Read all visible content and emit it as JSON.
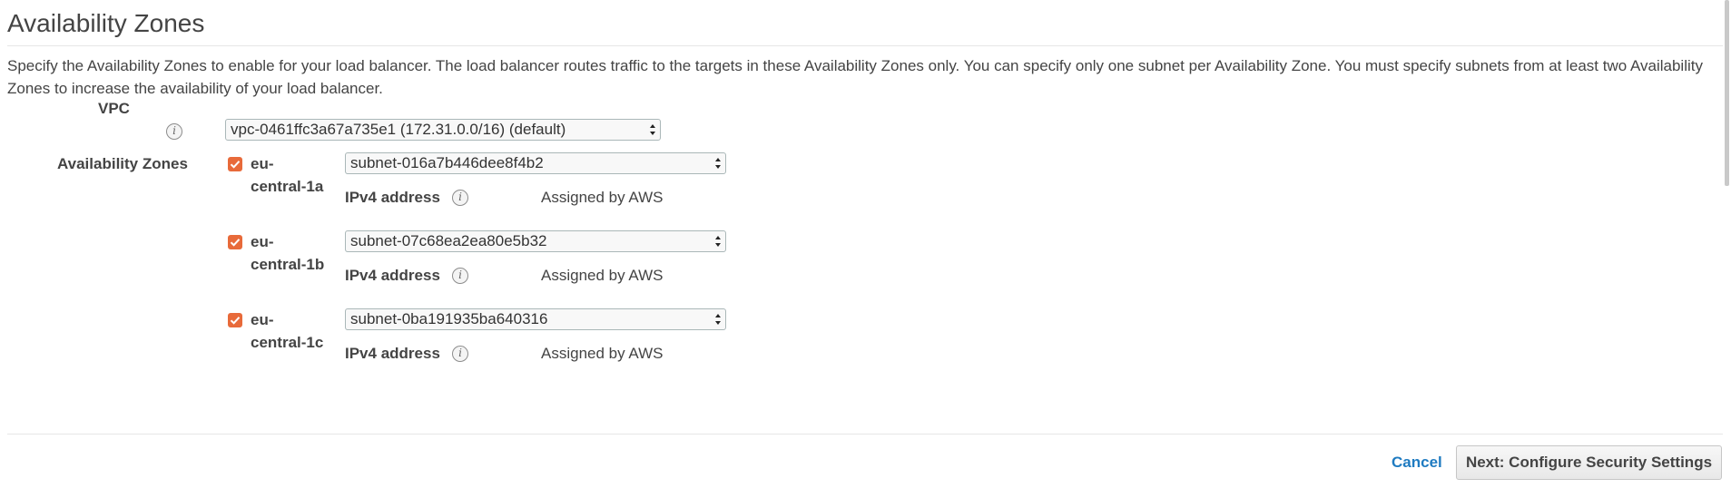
{
  "section": {
    "title": "Availability Zones",
    "description": "Specify the Availability Zones to enable for your load balancer. The load balancer routes traffic to the targets in these Availability Zones only. You can specify only one subnet per Availability Zone. You must specify subnets from at least two Availability Zones to increase the availability of your load balancer."
  },
  "vpc": {
    "label": "VPC",
    "info_icon": "info-icon",
    "value": "vpc-0461ffc3a67a735e1 (172.31.0.0/16) (default)"
  },
  "zones": {
    "label": "Availability Zones",
    "ipv4_label": "IPv4 address",
    "items": [
      {
        "name_line1": "eu-",
        "name_line2": "central-1a",
        "checked": true,
        "subnet": "subnet-016a7b446dee8f4b2",
        "ipv4_value": "Assigned by AWS"
      },
      {
        "name_line1": "eu-",
        "name_line2": "central-1b",
        "checked": true,
        "subnet": "subnet-07c68ea2ea80e5b32",
        "ipv4_value": "Assigned by AWS"
      },
      {
        "name_line1": "eu-",
        "name_line2": "central-1c",
        "checked": true,
        "subnet": "subnet-0ba191935ba640316",
        "ipv4_value": "Assigned by AWS"
      }
    ]
  },
  "footer": {
    "cancel_label": "Cancel",
    "next_label": "Next: Configure Security Settings"
  },
  "colors": {
    "checkbox": "#e86a3a",
    "link": "#1f7bc1"
  }
}
